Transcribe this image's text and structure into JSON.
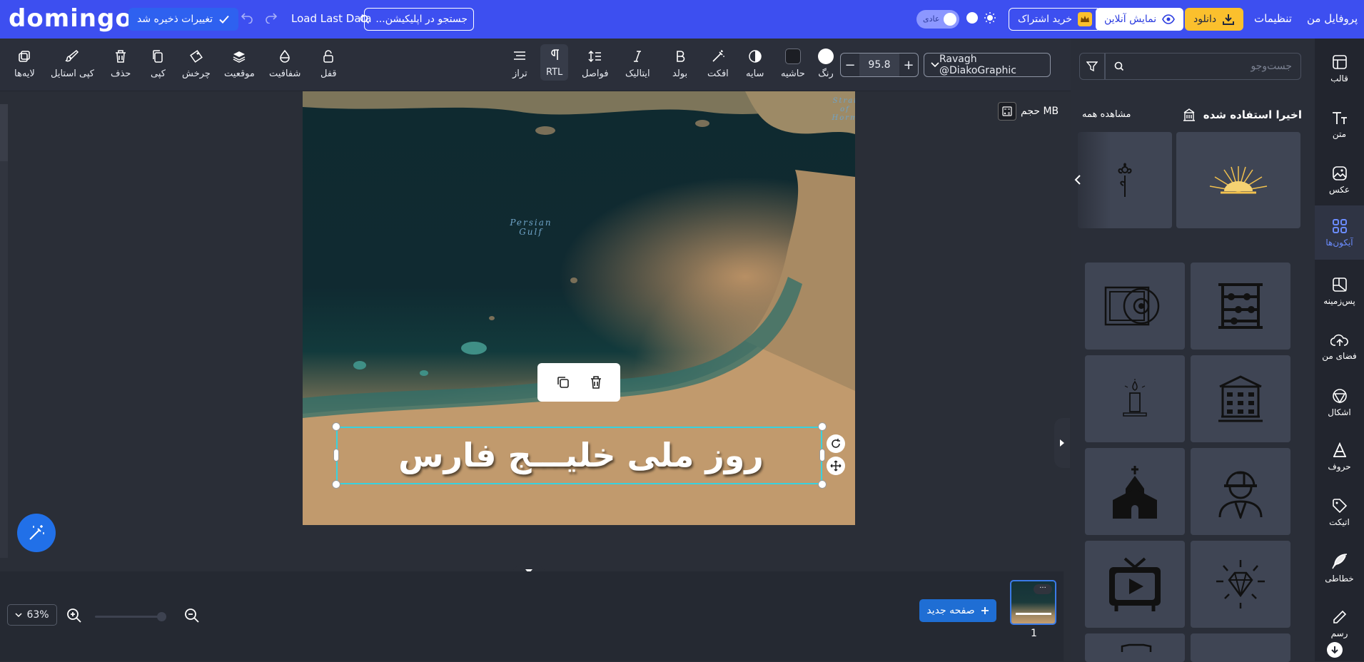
{
  "topbar": {
    "logo": "domingo",
    "save_status": "تغییرات ذخیره شد",
    "load_last": "Load Last Data",
    "search_placeholder": "جستجو در اپلیکیشن...",
    "mode_label": "عادی",
    "buy_label": "خرید اشتراک",
    "online_label": "نمایش آنلاین",
    "download_label": "دانلود",
    "settings_label": "تنظیمات",
    "profile_label": "پروفایل من"
  },
  "toolbar": {
    "layers": "لایه‌ها",
    "copy_style": "کپی استایل",
    "delete": "حذف",
    "copy": "کپی",
    "rotate": "چرخش",
    "position": "موقعیت",
    "opacity": "شفافیت",
    "lock": "قفل",
    "align": "تراز",
    "rtl": "RTL",
    "spacing": "فواصل",
    "italic": "ایتالیک",
    "bold": "بولد",
    "effect": "افکت",
    "shadow": "سایه",
    "border": "حاشیه",
    "color": "رنگ",
    "font_size": "95.8",
    "font_name": "Ravagh @DiakoGraphic"
  },
  "canvas": {
    "map_label_gulf_1": "Persian",
    "map_label_gulf_2": "Gulf",
    "map_label_strait_1": "Strai",
    "map_label_strait_2": "of",
    "map_label_strait_3": "Horm",
    "text": "روز ملی خلیـــج فارس",
    "size_label": "حجم MB"
  },
  "bottom": {
    "zoom": "63%",
    "new_page": "صفحه جدید",
    "page_number": "1",
    "thumb_more": "···"
  },
  "rightpanel": {
    "search_placeholder": "جست‌وجو",
    "recent_title": "اخیرا استفاده شده",
    "view_all": "مشاهده همه"
  },
  "nav": {
    "template": "قالب",
    "text": "متن",
    "photo": "عکس",
    "icons": "آیکون‌ها",
    "background": "پس‌زمینه",
    "my_space": "فضای من",
    "shapes": "اشکال",
    "letters": "حروف",
    "sticker": "اتیکت",
    "calligraphy": "خطاطی",
    "draw": "رسم"
  },
  "colors": {
    "topbar": "#3d4ff0",
    "accent_yellow": "#fbc02d",
    "selection": "#37d2e0",
    "primary_button": "#1f6ed4"
  }
}
